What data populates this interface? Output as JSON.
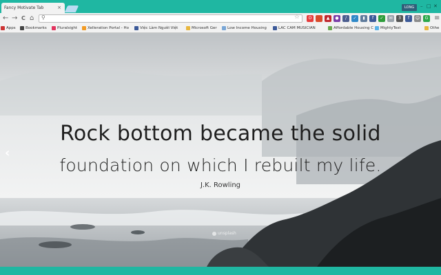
{
  "browser": {
    "tab_title": "Fancy Motivate Tab",
    "tab_close": "×",
    "user_label": "LONG",
    "window_buttons": [
      "–",
      "□",
      "✕"
    ],
    "nav": {
      "back": "←",
      "forward": "→",
      "reload": "C",
      "home": "⌂",
      "menu": "≡"
    },
    "omnibox_value": "",
    "accent": "#1fb7a2"
  },
  "extensions": [
    {
      "icon": "opera-icon",
      "color": "#e63c3c",
      "glyph": "O"
    },
    {
      "icon": "square-red-icon",
      "color": "#d94a2b",
      "glyph": ""
    },
    {
      "icon": "car-icon",
      "color": "#c0262d",
      "glyph": "▲"
    },
    {
      "icon": "palette-icon",
      "color": "#7a3ea8",
      "glyph": "●"
    },
    {
      "icon": "eyedropper-icon",
      "color": "#4b5d8f",
      "glyph": "/"
    },
    {
      "icon": "check-badge-icon",
      "color": "#2e88c8",
      "glyph": "✓"
    },
    {
      "icon": "pushbullet-icon",
      "color": "#5e7a9b",
      "glyph": "▮"
    },
    {
      "icon": "facebook-icon",
      "color": "#3b5998",
      "glyph": "f"
    },
    {
      "icon": "green-check-icon",
      "color": "#2e9d3b",
      "glyph": "✓"
    },
    {
      "icon": "mail-icon",
      "color": "#9aa3ab",
      "glyph": "✉"
    },
    {
      "icon": "dictionary-icon",
      "color": "#555555",
      "glyph": "3"
    },
    {
      "icon": "facebook2-icon",
      "color": "#3b5998",
      "glyph": "f"
    },
    {
      "icon": "smile-icon",
      "color": "#8b8b8b",
      "glyph": "☺"
    },
    {
      "icon": "grammarly-icon",
      "color": "#2aa74a",
      "glyph": "G"
    }
  ],
  "bookmarks": [
    {
      "label": "Apps",
      "icon": "apps-icon",
      "color": "#c33"
    },
    {
      "label": "Bookmarks",
      "icon": "star-icon",
      "color": "#444"
    },
    {
      "label": "Pluralsight",
      "icon": "pluralsight-icon",
      "color": "#e2345f"
    },
    {
      "label": "Xelleration Portal - Ho",
      "icon": "xelleration-icon",
      "color": "#f29b24"
    },
    {
      "label": "Việc Làm Người Việt",
      "icon": "facebook-bm-icon",
      "color": "#3b5998"
    },
    {
      "label": "Microsoft Ger",
      "icon": "folder-icon",
      "color": "#e8b73f"
    },
    {
      "label": "Low Income Housing",
      "icon": "lih-icon",
      "color": "#7aa7d6"
    },
    {
      "label": "LAC CAM MUSICIAN",
      "icon": "facebook-bm2-icon",
      "color": "#3b5998"
    },
    {
      "label": "Affordable Housing C",
      "icon": "leaf-icon",
      "color": "#6aa84f"
    },
    {
      "label": "MightyText",
      "icon": "mightytext-icon",
      "color": "#58b3e8"
    },
    {
      "label": "Othe",
      "icon": "folder2-icon",
      "color": "#e8b73f"
    }
  ],
  "quote": {
    "line1": "Rock bottom became the solid",
    "line2": "foundation on which I rebuilt my life.",
    "author": "J.K. Rowling"
  },
  "photo_credit": "unsplash"
}
